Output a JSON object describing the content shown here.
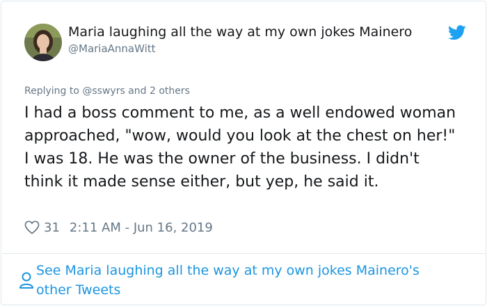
{
  "tweet": {
    "author": {
      "display_name": "Maria laughing all the way at my own jokes Mainero",
      "handle": "@MariaAnnaWitt"
    },
    "reply_context": {
      "prefix": "Replying to",
      "target": "@sswyrs and 2 others"
    },
    "text": "I had a boss comment to me, as a well endowed woman approached, \"wow, would you look at the chest on her!\" I was 18. He was the owner of the business. I didn't think it made sense either, but yep, he said it.",
    "likes": "31",
    "timestamp": "2:11 AM - Jun 16, 2019"
  },
  "footer": {
    "other_tweets": "See Maria laughing all the way at my own jokes Mainero's other Tweets"
  },
  "colors": {
    "link_blue": "#1b95e0",
    "twitter_blue": "#1da1f2",
    "muted_gray": "#657786",
    "text_dark": "#14171a"
  },
  "icons": {
    "brand": "twitter-bird-icon",
    "like": "heart-icon",
    "profile": "person-icon"
  }
}
